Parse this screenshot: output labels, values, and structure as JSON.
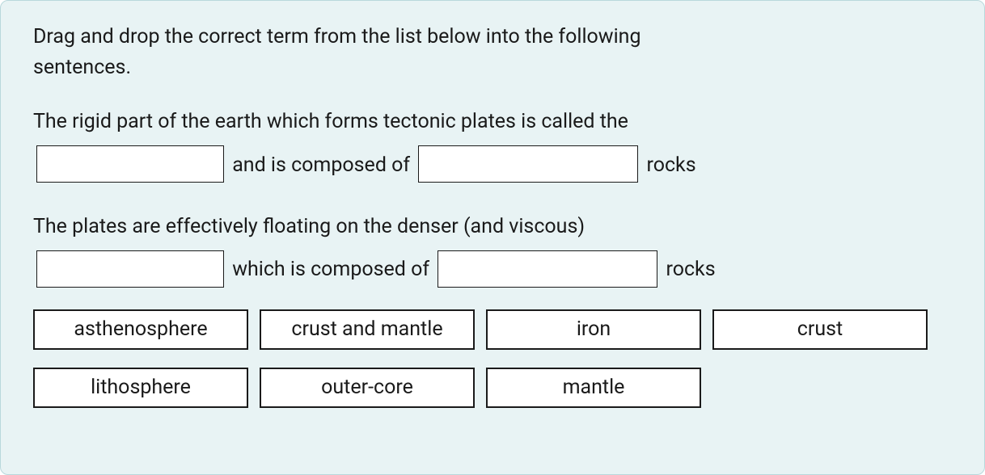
{
  "instructions": "Drag and drop the correct term from the list below into the following sentences.",
  "sentence1": {
    "part1": "The rigid part of the earth which forms tectonic plates is called the ",
    "part2": " and is composed of ",
    "part3": " rocks"
  },
  "sentence2": {
    "part1": "The plates are effectively floating on the denser (and viscous) ",
    "part2": " which is composed of ",
    "part3": " rocks"
  },
  "terms": {
    "t1": "asthenosphere",
    "t2": "crust and mantle",
    "t3": "iron",
    "t4": "crust",
    "t5": "lithosphere",
    "t6": "outer-core",
    "t7": "mantle"
  }
}
